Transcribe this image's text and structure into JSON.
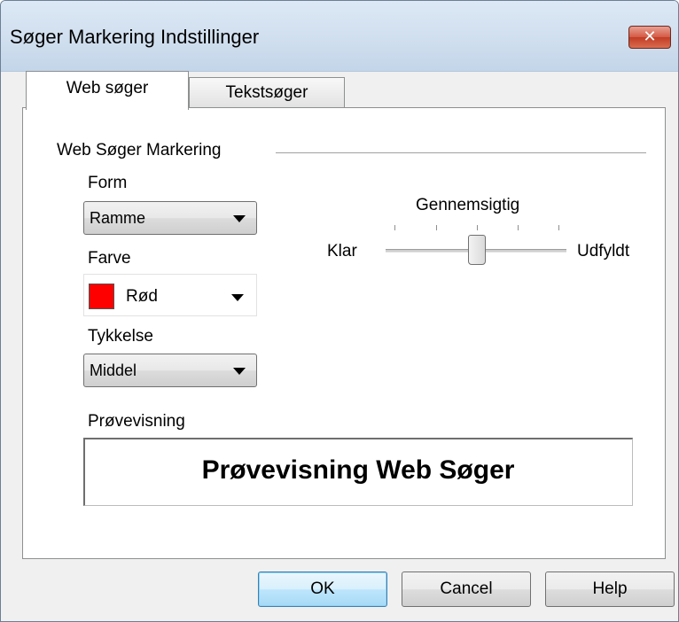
{
  "window": {
    "title": "Søger Markering Indstillinger",
    "close_glyph": "✕"
  },
  "tabs": [
    {
      "label": "Web søger",
      "selected": true
    },
    {
      "label": "Tekstsøger",
      "selected": false
    }
  ],
  "group": {
    "title": "Web Søger Markering",
    "form": {
      "label": "Form",
      "value": "Ramme"
    },
    "color": {
      "label": "Farve",
      "value": "Rød",
      "swatch": "#ff0000"
    },
    "thickness": {
      "label": "Tykkelse",
      "value": "Middel"
    },
    "transparency": {
      "label": "Gennemsigtig",
      "min_label": "Klar",
      "max_label": "Udfyldt",
      "value_fraction": 0.5
    },
    "preview": {
      "label": "Prøvevisning",
      "text": "Prøvevisning Web Søger"
    }
  },
  "buttons": {
    "ok": "OK",
    "cancel": "Cancel",
    "help": "Help"
  }
}
